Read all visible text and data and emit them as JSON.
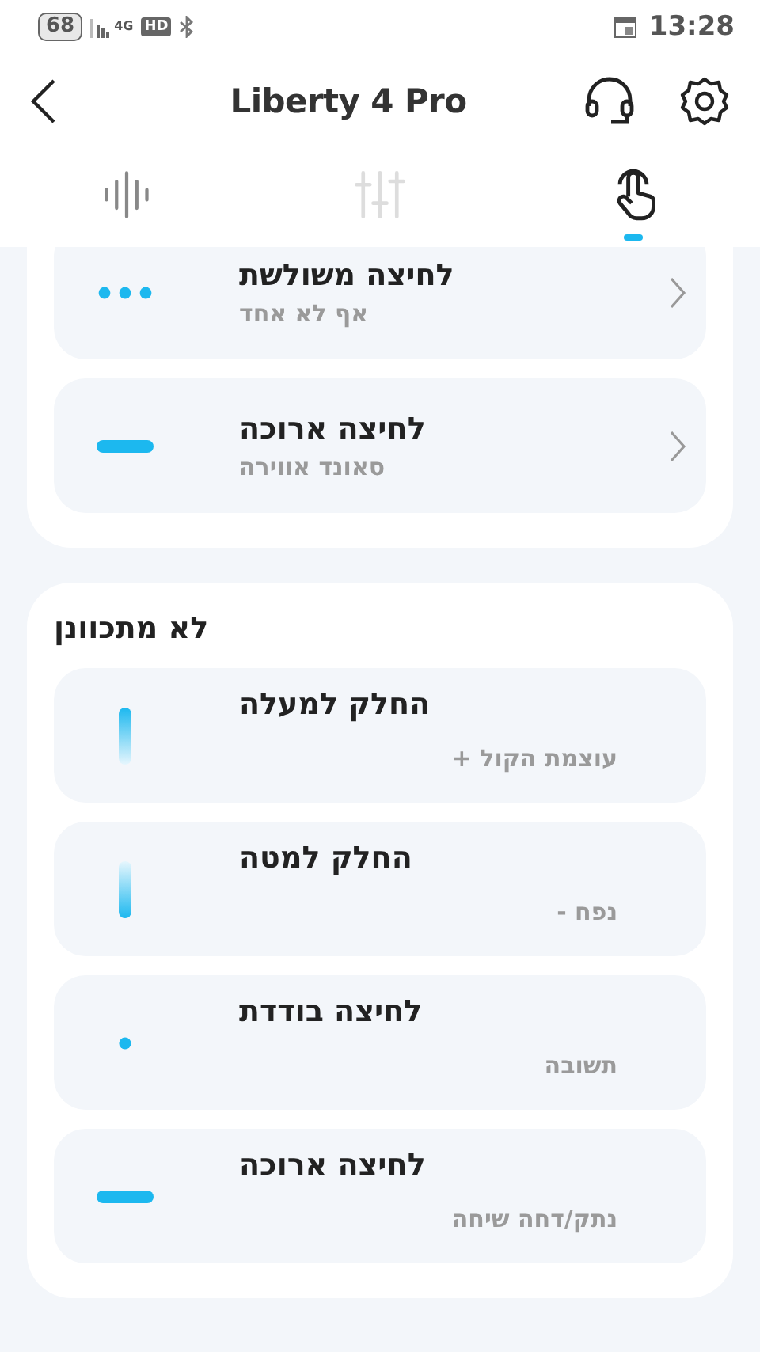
{
  "status_bar": {
    "battery": "68",
    "network": "4G",
    "hd": "HD",
    "time": "13:28"
  },
  "header": {
    "title": "Liberty 4 Pro"
  },
  "tabs": [
    {
      "kind": "sound",
      "selected": false
    },
    {
      "kind": "equalizer",
      "selected": false
    },
    {
      "kind": "gesture",
      "selected": true
    }
  ],
  "sections": [
    {
      "kind": "adjustable",
      "items": [
        {
          "kind": "triple",
          "title": "לחיצה משולשת",
          "subtitle": "אף לא אחד"
        },
        {
          "kind": "long",
          "title": "לחיצה ארוכה",
          "subtitle": "סאונד אווירה"
        }
      ]
    },
    {
      "kind": "fixed",
      "title": "לא מתכוונן",
      "items": [
        {
          "kind": "slide-up",
          "title": "החלק למעלה",
          "subtitle": "עוצמת הקול +"
        },
        {
          "kind": "slide-down",
          "title": "החלק למטה",
          "subtitle": "נפח -"
        },
        {
          "kind": "single",
          "title": "לחיצה בודדת",
          "subtitle": "תשובה"
        },
        {
          "kind": "long",
          "title": "לחיצה ארוכה",
          "subtitle": "נתק/דחה שיחה"
        }
      ]
    }
  ]
}
